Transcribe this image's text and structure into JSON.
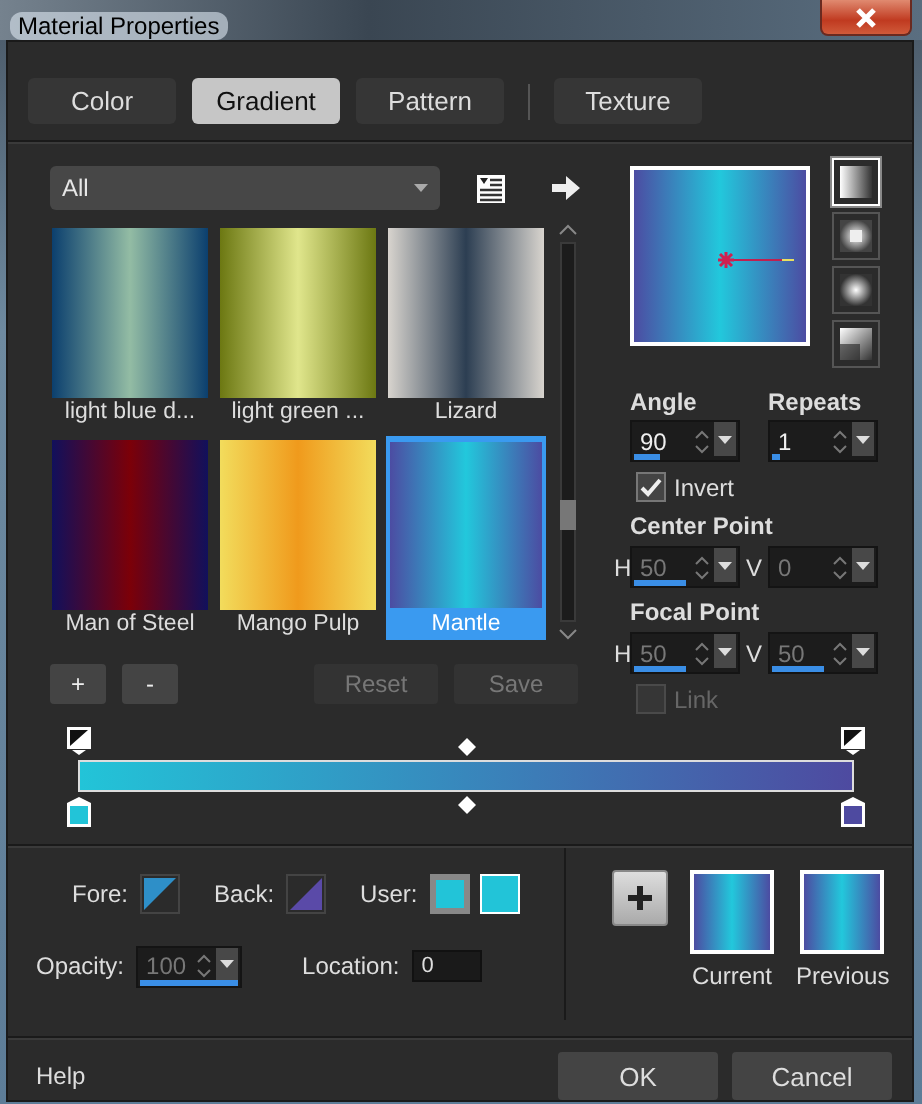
{
  "window": {
    "title": "Material Properties"
  },
  "tabs": [
    {
      "label": "Color",
      "selected": false
    },
    {
      "label": "Gradient",
      "selected": true
    },
    {
      "label": "Pattern",
      "selected": false
    },
    {
      "label": "Texture",
      "selected": false
    }
  ],
  "library": {
    "category": "All",
    "items": [
      {
        "name": "light blue d...",
        "stops": [
          {
            "color": "#0b3f6e"
          },
          {
            "color": "#93bca4"
          },
          {
            "color": "#0b3f6e"
          }
        ],
        "selected": false
      },
      {
        "name": "light green ...",
        "stops": [
          {
            "color": "#6c7812"
          },
          {
            "color": "#e0e68c"
          },
          {
            "color": "#6c7812"
          }
        ],
        "selected": false
      },
      {
        "name": "Lizard",
        "stops": [
          {
            "color": "#d8d4ce"
          },
          {
            "color": "#2c3e52"
          },
          {
            "color": "#d8d4ce"
          }
        ],
        "selected": false
      },
      {
        "name": "Man of Steel",
        "stops": [
          {
            "color": "#11105c"
          },
          {
            "color": "#7c0008"
          },
          {
            "color": "#11105c"
          }
        ],
        "selected": false
      },
      {
        "name": "Mango Pulp",
        "stops": [
          {
            "color": "#f2dc5c"
          },
          {
            "color": "#f09a1c"
          },
          {
            "color": "#f2dc5c"
          }
        ],
        "selected": false
      },
      {
        "name": "Mantle",
        "stops": [
          {
            "color": "#4c4ca2"
          },
          {
            "color": "#22c8dc"
          },
          {
            "color": "#4c4ca2"
          }
        ],
        "selected": true
      }
    ]
  },
  "library_buttons": [
    {
      "label": "+",
      "disabled": false
    },
    {
      "label": "-",
      "disabled": false
    },
    {
      "label": "Reset",
      "disabled": true
    },
    {
      "label": "Save",
      "disabled": true
    }
  ],
  "styles": [
    {
      "kind": "linear",
      "selected": true
    },
    {
      "kind": "rectangular",
      "selected": false
    },
    {
      "kind": "sunburst",
      "selected": false
    },
    {
      "kind": "radial",
      "selected": false
    }
  ],
  "angle": {
    "label": "Angle",
    "value": "90",
    "level": 0.25,
    "disabled": false
  },
  "repeats": {
    "label": "Repeats",
    "value": "1",
    "level": 0.07,
    "disabled": false
  },
  "invert": {
    "label": "Invert",
    "checked": true,
    "disabled": false
  },
  "center_point": {
    "label": "Center Point",
    "h": {
      "label": "H",
      "value": "50",
      "level": 0.5,
      "disabled": true
    },
    "v": {
      "label": "V",
      "value": "0",
      "disabled": true
    }
  },
  "focal_point": {
    "label": "Focal Point",
    "h": {
      "label": "H",
      "value": "50",
      "level": 0.5,
      "disabled": true
    },
    "v": {
      "label": "V",
      "value": "50",
      "level": 0.5,
      "disabled": true
    }
  },
  "link": {
    "label": "Link",
    "checked": false,
    "disabled": true
  },
  "stops": [
    {
      "color": "#22c4d8"
    },
    {
      "color": "#4e4aa0"
    }
  ],
  "fore": {
    "label": "Fore:",
    "color": "#2e8fc8"
  },
  "back": {
    "label": "Back:",
    "color": "#5a4aa8"
  },
  "user": {
    "label": "User:",
    "colors": [
      {
        "color": "#22c4d8"
      },
      {
        "color": "#22c4d8"
      }
    ]
  },
  "opacity": {
    "label": "Opacity:",
    "value": "100",
    "level": 1,
    "disabled": true
  },
  "location": {
    "label": "Location:",
    "value": "0"
  },
  "current": {
    "label": "Current"
  },
  "previous": {
    "label": "Previous"
  },
  "footer": {
    "help": "Help",
    "ok": "OK",
    "cancel": "Cancel"
  }
}
